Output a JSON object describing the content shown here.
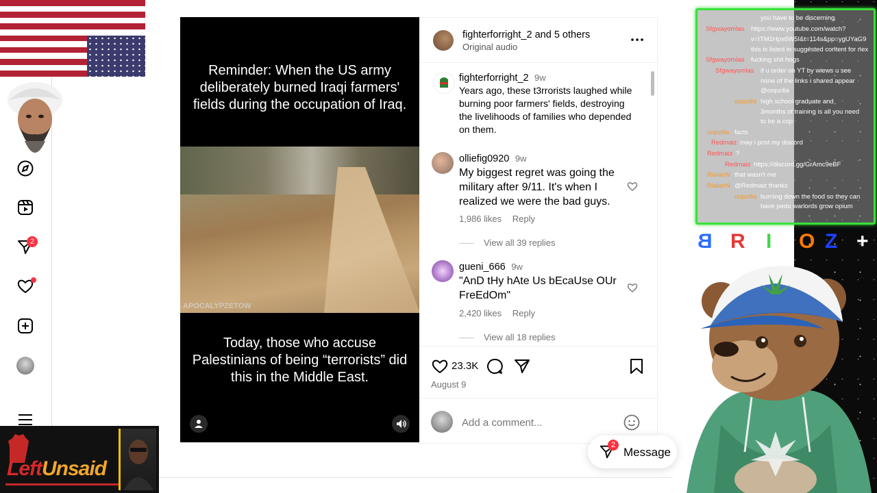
{
  "nav": {
    "items": [
      "explore",
      "reels",
      "messages",
      "notifications",
      "create",
      "profile",
      "more"
    ],
    "messages_badge": "2"
  },
  "video": {
    "top_text": "Reminder: When the US army deliberately burned Iraqi farmers' fields during the occupation of Iraq.",
    "bottom_text": "Today, those who accuse Palestinians of being “terrorists” did this in the Middle East.",
    "watermark": "APOCALYPZETOW"
  },
  "post": {
    "header": {
      "author": "fighterforright_2",
      "and_others_pre": "and",
      "and_others": "5 others",
      "audio": "Original audio"
    },
    "caption": {
      "user": "fighterforright_2",
      "time": "9w",
      "text": "Years ago, these t3rrorists laughed while burning poor farmers' fields, destroying the livelihoods of families who depended on them."
    },
    "comments": [
      {
        "user": "olliefig0920",
        "time": "9w",
        "text": "My biggest regret was going the military after 9/11. It's when I realized we were the bad guys.",
        "likes": "1,986 likes",
        "reply": "Reply",
        "view_replies": "View all 39 replies"
      },
      {
        "user": "gueni_666",
        "time": "9w",
        "text": "\"AnD tHy hAte Us bEcaUse OUr FreEdOm\"",
        "likes": "2,420 likes",
        "reply": "Reply",
        "view_replies": "View all 18 replies"
      }
    ],
    "likes_count": "23.3K",
    "date": "August 9",
    "comment_placeholder": "Add a comment...",
    "more_label": "..."
  },
  "message_button": {
    "label": "Message",
    "badge": "2"
  },
  "banner": {
    "left_word": "Left",
    "right_word": "Unsaid"
  },
  "chat": {
    "lines": [
      {
        "name": "",
        "text": "you have to be discerning"
      },
      {
        "name": "Sfgwayomlas",
        "text": "https://www.youtube.com/watch?"
      },
      {
        "name": "",
        "text": "v=ITM1Hpx6W5I&t=114s&pp=ygUYaG9"
      },
      {
        "name": "",
        "text": "this is listed in suggested content for nex"
      },
      {
        "name": "Sfgwayomlas",
        "text": "fucking shit hogs"
      },
      {
        "name": "Sfgwayomlas",
        "text": "if u order on YT by wiews u see"
      },
      {
        "name": "",
        "text": "none of the links i shared appear"
      },
      {
        "name": "",
        "text": "@oopzilla"
      },
      {
        "name": "oopzilla",
        "text": "high school graduate and"
      },
      {
        "name": "",
        "text": "3months of training is all you need"
      },
      {
        "name": "",
        "text": "to be a cop"
      },
      {
        "name": "oopzilla",
        "text": "facts"
      },
      {
        "name": "Redmaiz",
        "text": "may i post my discord"
      },
      {
        "name": "Redmaiz",
        "text": "?"
      },
      {
        "name": "Redmaiz",
        "text": "https://discord.gg/GrAmc9eBF"
      },
      {
        "name": "RialanN",
        "text": "that wasn't me"
      },
      {
        "name": "RialanN",
        "text": "@Redmaiz thanks"
      },
      {
        "name": "oopzilla",
        "text": "burning down the food so they can"
      },
      {
        "name": "",
        "text": "have pedo warlords grow opium"
      }
    ]
  },
  "letters": [
    "B",
    "R",
    "I",
    "O",
    "Z",
    "+"
  ],
  "colors": {
    "chat_border": "#3ae03a",
    "like_badge": "#ff3040",
    "flag_red": "#b22234",
    "flag_blue": "#3c3b6e",
    "hoodie_green": "#4fa07a"
  }
}
